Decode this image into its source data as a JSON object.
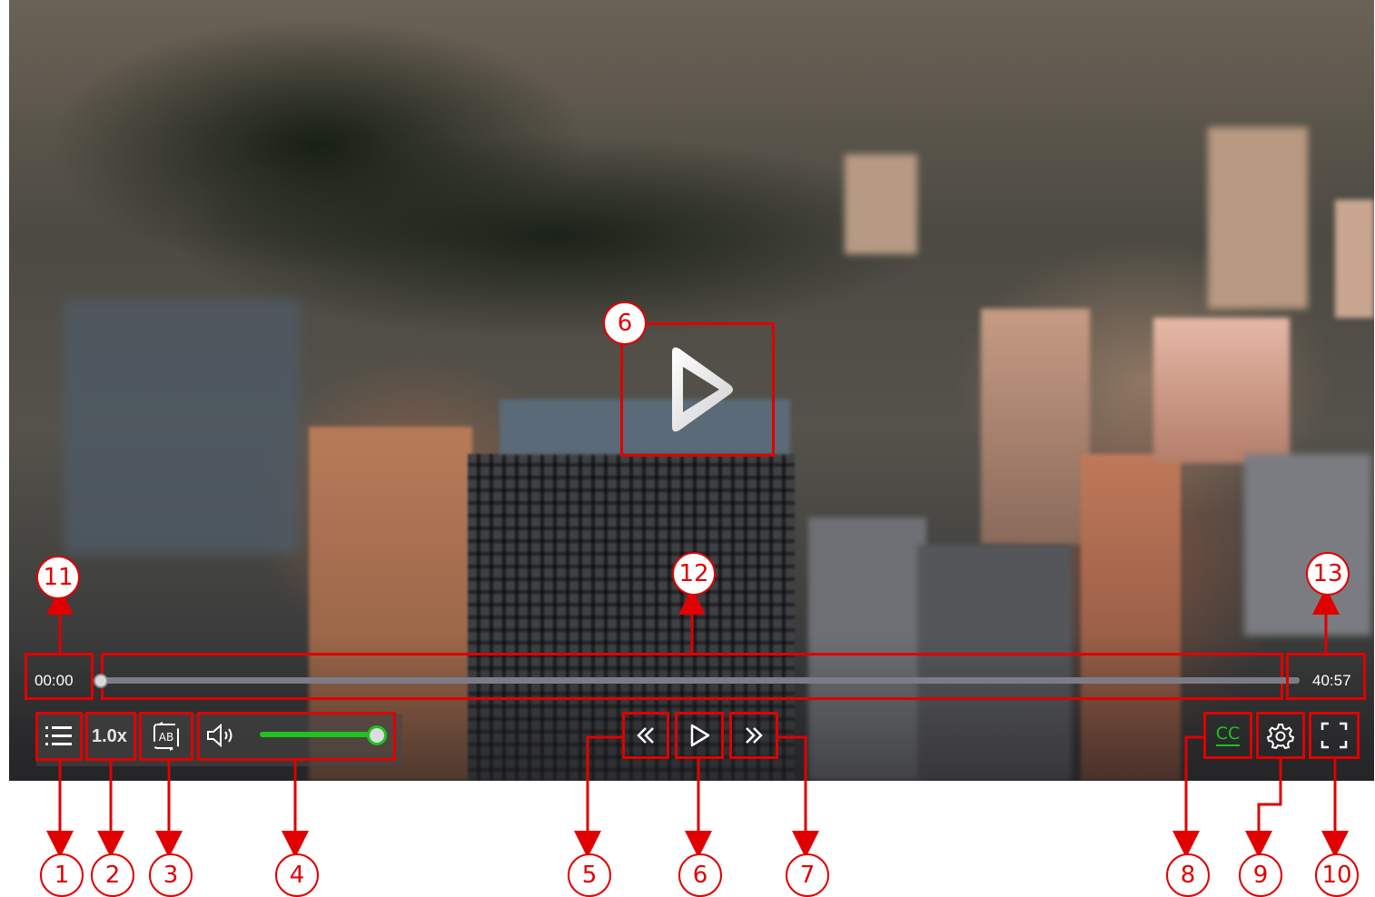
{
  "player": {
    "time_current": "00:00",
    "time_total": "40:57",
    "speed_label": "1.0x",
    "cc_label": "CC",
    "progress_fraction": 0.0,
    "volume_fraction": 0.95,
    "accent_color": "#1fc21f",
    "annotation_color": "#e00000"
  },
  "icons": {
    "playlist": "list-icon",
    "ab_repeat": "ab-repeat-icon",
    "volume": "volume-icon",
    "rewind": "rewind-icon",
    "play": "play-icon",
    "forward": "fast-forward-icon",
    "settings": "gear-icon",
    "fullscreen": "fullscreen-icon"
  },
  "callouts": [
    "1",
    "2",
    "3",
    "4",
    "5",
    "6",
    "7",
    "8",
    "9",
    "10",
    "11",
    "12",
    "13",
    "6"
  ]
}
